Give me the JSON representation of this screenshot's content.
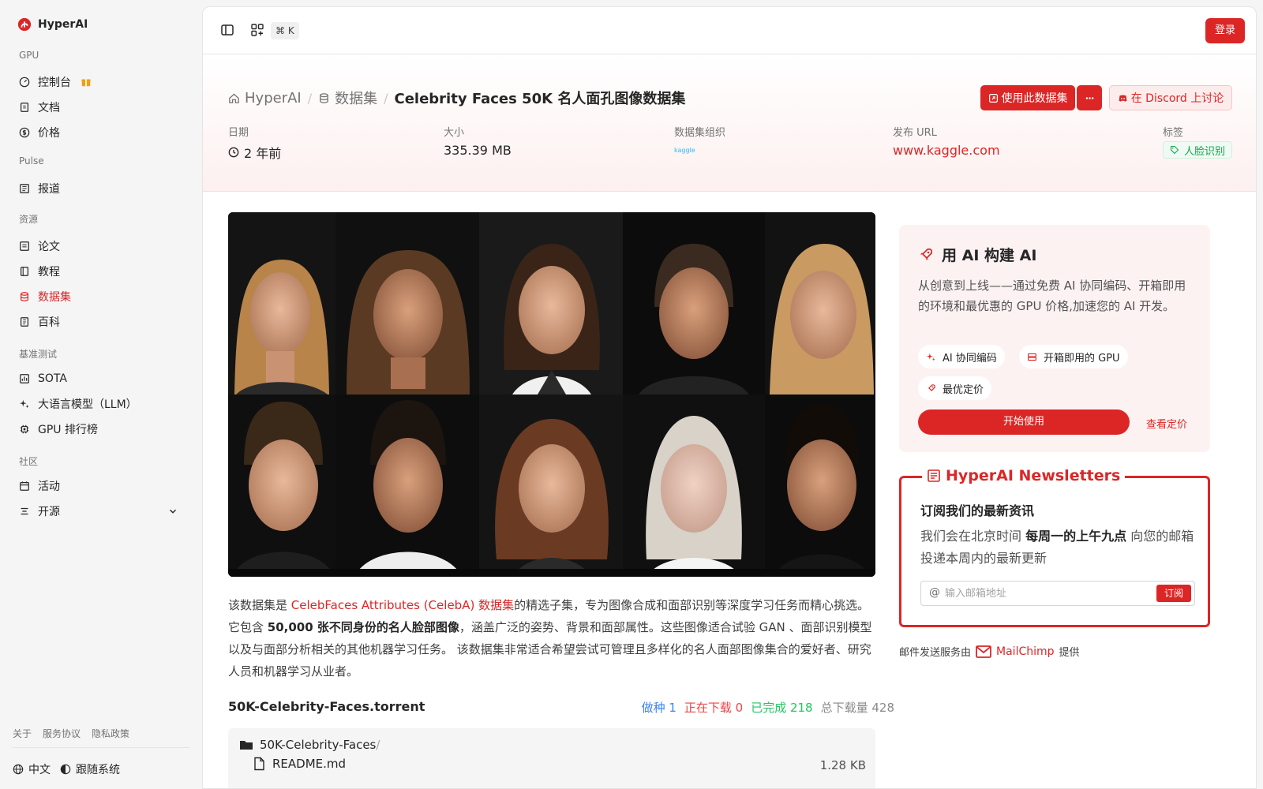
{
  "brand": {
    "name": "HyperAI"
  },
  "sidebar": {
    "groups": [
      {
        "title": "GPU",
        "items": [
          {
            "label": "控制台",
            "icon": "gauge-icon"
          },
          {
            "label": "文档",
            "icon": "book-icon"
          },
          {
            "label": "价格",
            "icon": "dollar-icon"
          }
        ]
      },
      {
        "title": "Pulse",
        "items": [
          {
            "label": "报道",
            "icon": "newspaper-icon"
          }
        ]
      },
      {
        "title": "资源",
        "items": [
          {
            "label": "论文",
            "icon": "document-icon"
          },
          {
            "label": "教程",
            "icon": "notebook-icon"
          },
          {
            "label": "数据集",
            "icon": "database-icon",
            "active": true
          },
          {
            "label": "百科",
            "icon": "book-open-icon"
          }
        ]
      },
      {
        "title": "基准测试",
        "items": [
          {
            "label": "SOTA",
            "icon": "trophy-icon"
          },
          {
            "label": "大语言模型（LLM）",
            "icon": "sparkles-icon"
          },
          {
            "label": "GPU 排行榜",
            "icon": "chip-icon"
          }
        ]
      },
      {
        "title": "社区",
        "items": [
          {
            "label": "活动",
            "icon": "calendar-icon"
          },
          {
            "label": "开源",
            "icon": "list-icon"
          }
        ]
      }
    ],
    "footer_links": [
      "关于",
      "服务协议",
      "隐私政策"
    ],
    "language": "中文",
    "theme": "跟随系统"
  },
  "topbar": {
    "shortcut": "⌘ K",
    "login_label": "登录"
  },
  "header": {
    "breadcrumb": [
      "HyperAI",
      "数据集",
      "Celebrity Faces 50K 名人面孔图像数据集"
    ],
    "use_label": "使用此数据集",
    "discord_label": "在 Discord 上讨论",
    "meta": {
      "date_label": "日期",
      "date_value": "2 年前",
      "size_label": "大小",
      "size_value": "335.39 MB",
      "org_label": "数据集组织",
      "org_value": "kaggle",
      "url_label": "发布 URL",
      "url_value": "www.kaggle.com",
      "tags_label": "标签",
      "tag_value": "人脸识别"
    }
  },
  "content": {
    "desc_1": "该数据集是 ",
    "desc_link": "CelebFaces Attributes (CelebA) 数据集",
    "desc_2": "的精选子集，专为图像合成和面部识别等深度学习任务而精心挑选。它包含 ",
    "desc_bold": "50,000 张不同身份的名人脸部图像",
    "desc_3": "，涵盖广泛的姿势、背景和面部属性。这些图像适合试验 GAN 、面部识别模型以及与面部分析相关的其他机器学习任务。 该数据集非常适合希望尝试可管理且多样化的名人面部图像集合的爱好者、研究人员和机器学习从业者。",
    "torrent_title": "50K-Celebrity-Faces.torrent",
    "stats": {
      "seed": "做种 1",
      "downloading": "正在下载 0",
      "done": "已完成 218",
      "total": "总下载量 428"
    },
    "folder": "50K-Celebrity-Faces",
    "folder_sep": "/",
    "file_name": "README.md",
    "file_size": "1.28 KB"
  },
  "promo": {
    "title": "用 AI 构建 AI",
    "desc": "从创意到上线——通过免费 AI 协同编码、开箱即用的环境和最优惠的 GPU 价格,加速您的 AI 开发。",
    "chips": [
      "AI 协同编码",
      "开箱即用的 GPU",
      "最优定价"
    ],
    "start_label": "开始使用",
    "pricing_label": "查看定价"
  },
  "newsletter": {
    "title": "HyperAI Newsletters",
    "head": "订阅我们的最新资讯",
    "text_1": "我们会在北京时间 ",
    "text_bold": "每周一的上午九点",
    "text_2": " 向您的邮箱投递本周内的最新更新",
    "placeholder": "输入邮箱地址",
    "subscribe_label": "订阅",
    "provider_pre": "邮件发送服务由",
    "provider": "MailChimp",
    "provider_post": "提供"
  },
  "colors": {
    "accent": "#dc2626",
    "seed": "#3b82f6",
    "downloading": "#ef4444",
    "done": "#22c55e"
  }
}
